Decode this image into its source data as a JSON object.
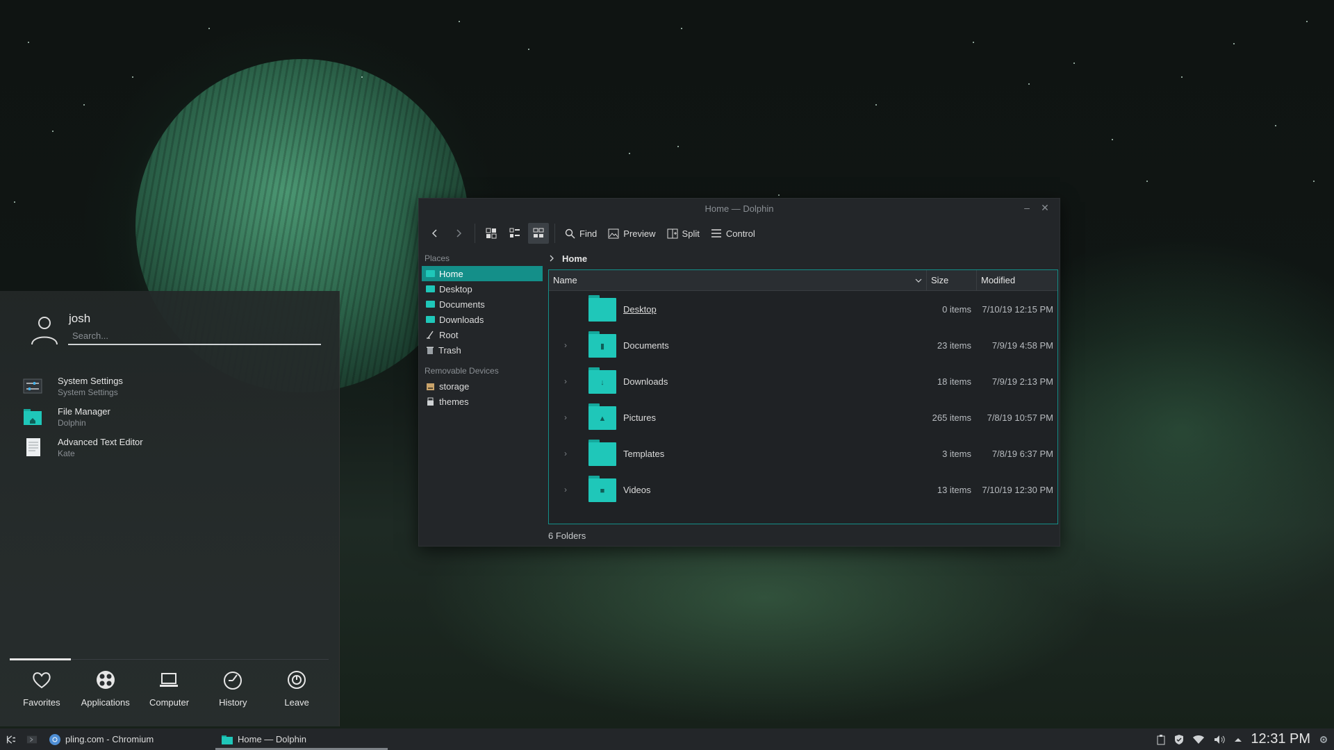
{
  "dolphin": {
    "title": "Home — Dolphin",
    "toolbar": {
      "find": "Find",
      "preview": "Preview",
      "split": "Split",
      "control": "Control"
    },
    "places_heading": "Places",
    "places": [
      {
        "label": "Home",
        "icon": "home-folder-icon"
      },
      {
        "label": "Desktop",
        "icon": "folder-icon"
      },
      {
        "label": "Documents",
        "icon": "folder-icon"
      },
      {
        "label": "Downloads",
        "icon": "folder-icon"
      },
      {
        "label": "Root",
        "icon": "root-icon"
      },
      {
        "label": "Trash",
        "icon": "trash-icon"
      }
    ],
    "removable_heading": "Removable Devices",
    "removable": [
      {
        "label": "storage",
        "icon": "drive-icon"
      },
      {
        "label": "themes",
        "icon": "usb-drive-icon"
      }
    ],
    "breadcrumb": "Home",
    "columns": {
      "name": "Name",
      "size": "Size",
      "modified": "Modified"
    },
    "files": [
      {
        "name": "Desktop",
        "size": "0 items",
        "modified": "7/10/19 12:15 PM"
      },
      {
        "name": "Documents",
        "size": "23 items",
        "modified": "7/9/19 4:58 PM"
      },
      {
        "name": "Downloads",
        "size": "18 items",
        "modified": "7/9/19 2:13 PM"
      },
      {
        "name": "Pictures",
        "size": "265 items",
        "modified": "7/8/19 10:57 PM"
      },
      {
        "name": "Templates",
        "size": "3 items",
        "modified": "7/8/19 6:37 PM"
      },
      {
        "name": "Videos",
        "size": "13 items",
        "modified": "7/10/19 12:30 PM"
      }
    ],
    "status": "6 Folders",
    "accent": "#148f89",
    "folder_color": "#1fc7b9"
  },
  "launcher": {
    "username": "josh",
    "search_placeholder": "Search...",
    "favorites": [
      {
        "title": "System Settings",
        "subtitle": "System Settings"
      },
      {
        "title": "File Manager",
        "subtitle": "Dolphin"
      },
      {
        "title": "Advanced Text Editor",
        "subtitle": "Kate"
      }
    ],
    "tabs": [
      "Favorites",
      "Applications",
      "Computer",
      "History",
      "Leave"
    ]
  },
  "taskbar": {
    "tasks": [
      "pling.com - Chromium",
      "Home — Dolphin"
    ],
    "clock": "12:31 PM"
  }
}
